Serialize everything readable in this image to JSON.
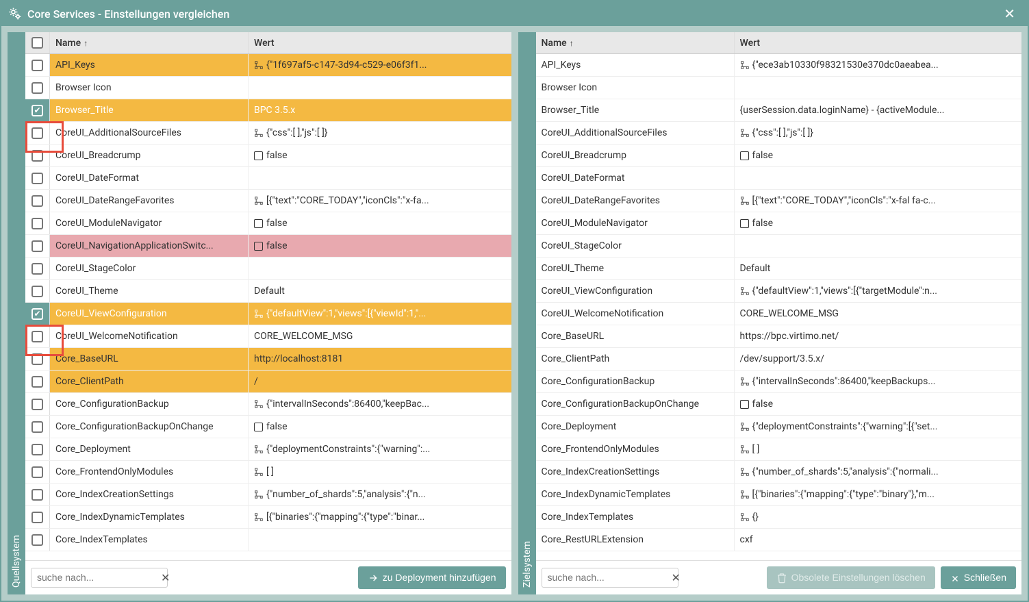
{
  "window": {
    "title": "Core Services - Einstellungen vergleichen"
  },
  "headers": {
    "name": "Name",
    "value": "Wert",
    "sort_indicator": "↑"
  },
  "sidetabs": {
    "source": "Quellsystem",
    "target": "Zielsystem"
  },
  "search": {
    "placeholder": "suche nach...",
    "clear": "✕"
  },
  "buttons": {
    "add_deploy": "zu Deployment hinzufügen",
    "obsolete": "Obsolete Einstellungen löschen",
    "close": "Schließen"
  },
  "source_rows": [
    {
      "name": "API_Keys",
      "value": "{\"1f697af5-c147-3d94-c529-e06f3f1...",
      "state": "diff",
      "icon": "tree",
      "sel": false
    },
    {
      "name": "Browser Icon",
      "value": "",
      "state": "",
      "icon": "",
      "sel": false
    },
    {
      "name": "Browser_Title",
      "value": "BPC 3.5.x",
      "state": "diff",
      "icon": "",
      "sel": true
    },
    {
      "name": "CoreUI_AdditionalSourceFiles",
      "value": "{\"css\":[ ],\"js\":[ ]}",
      "state": "",
      "icon": "tree",
      "sel": false
    },
    {
      "name": "CoreUI_Breadcrump",
      "value": "false",
      "state": "",
      "icon": "bool",
      "sel": false
    },
    {
      "name": "CoreUI_DateFormat",
      "value": "",
      "state": "",
      "icon": "",
      "sel": false
    },
    {
      "name": "CoreUI_DateRangeFavorites",
      "value": "[{\"text\":\"CORE_TODAY\",\"iconCls\":\"x-fa...",
      "state": "",
      "icon": "tree",
      "sel": false
    },
    {
      "name": "CoreUI_ModuleNavigator",
      "value": "false",
      "state": "",
      "icon": "bool",
      "sel": false
    },
    {
      "name": "CoreUI_NavigationApplicationSwitc...",
      "value": "false",
      "state": "missing",
      "icon": "bool",
      "sel": false
    },
    {
      "name": "CoreUI_StageColor",
      "value": "",
      "state": "",
      "icon": "",
      "sel": false
    },
    {
      "name": "CoreUI_Theme",
      "value": "Default",
      "state": "",
      "icon": "",
      "sel": false
    },
    {
      "name": "CoreUI_ViewConfiguration",
      "value": "{\"defaultView\":1,\"views\":[{\"viewId\":1,\"...",
      "state": "diff",
      "icon": "tree",
      "sel": true
    },
    {
      "name": "CoreUI_WelcomeNotification",
      "value": "CORE_WELCOME_MSG",
      "state": "",
      "icon": "",
      "sel": false
    },
    {
      "name": "Core_BaseURL",
      "value": "http://localhost:8181",
      "state": "diff",
      "icon": "",
      "sel": false
    },
    {
      "name": "Core_ClientPath",
      "value": "/",
      "state": "diff",
      "icon": "",
      "sel": false
    },
    {
      "name": "Core_ConfigurationBackup",
      "value": "{\"intervalInSeconds\":86400,\"keepBac...",
      "state": "",
      "icon": "tree",
      "sel": false
    },
    {
      "name": "Core_ConfigurationBackupOnChange",
      "value": "false",
      "state": "",
      "icon": "bool",
      "sel": false
    },
    {
      "name": "Core_Deployment",
      "value": "{\"deploymentConstraints\":{\"warning\":...",
      "state": "",
      "icon": "tree",
      "sel": false
    },
    {
      "name": "Core_FrontendOnlyModules",
      "value": "[ ]",
      "state": "",
      "icon": "tree",
      "sel": false
    },
    {
      "name": "Core_IndexCreationSettings",
      "value": "{\"number_of_shards\":5,\"analysis\":{\"n...",
      "state": "",
      "icon": "tree",
      "sel": false
    },
    {
      "name": "Core_IndexDynamicTemplates",
      "value": "[{\"binaries\":{\"mapping\":{\"type\":\"binar...",
      "state": "",
      "icon": "tree",
      "sel": false
    },
    {
      "name": "Core_IndexTemplates",
      "value": "",
      "state": "",
      "icon": "",
      "sel": false
    }
  ],
  "target_rows": [
    {
      "name": "API_Keys",
      "value": "{\"ece3ab10330f98321530e370dc0aeabea...",
      "icon": "tree"
    },
    {
      "name": "Browser Icon",
      "value": "",
      "icon": ""
    },
    {
      "name": "Browser_Title",
      "value": "{userSession.data.loginName} - {activeModule...",
      "icon": ""
    },
    {
      "name": "CoreUI_AdditionalSourceFiles",
      "value": "{\"css\":[ ],\"js\":[ ]}",
      "icon": "tree"
    },
    {
      "name": "CoreUI_Breadcrump",
      "value": "false",
      "icon": "bool"
    },
    {
      "name": "CoreUI_DateFormat",
      "value": "",
      "icon": ""
    },
    {
      "name": "CoreUI_DateRangeFavorites",
      "value": "[{\"text\":\"CORE_TODAY\",\"iconCls\":\"x-fal fa-c...",
      "icon": "tree"
    },
    {
      "name": "CoreUI_ModuleNavigator",
      "value": "false",
      "icon": "bool"
    },
    {
      "name": "CoreUI_StageColor",
      "value": "",
      "icon": ""
    },
    {
      "name": "CoreUI_Theme",
      "value": "Default",
      "icon": ""
    },
    {
      "name": "CoreUI_ViewConfiguration",
      "value": "{\"defaultView\":1,\"views\":[{\"targetModule\":n...",
      "icon": "tree"
    },
    {
      "name": "CoreUI_WelcomeNotification",
      "value": "CORE_WELCOME_MSG",
      "icon": ""
    },
    {
      "name": "Core_BaseURL",
      "value": "https://bpc.virtimo.net/",
      "icon": ""
    },
    {
      "name": "Core_ClientPath",
      "value": "/dev/support/3.5.x/",
      "icon": ""
    },
    {
      "name": "Core_ConfigurationBackup",
      "value": "{\"intervalInSeconds\":86400,\"keepBackups...",
      "icon": "tree"
    },
    {
      "name": "Core_ConfigurationBackupOnChange",
      "value": "false",
      "icon": "bool"
    },
    {
      "name": "Core_Deployment",
      "value": "{\"deploymentConstraints\":{\"warning\":[{\"set...",
      "icon": "tree"
    },
    {
      "name": "Core_FrontendOnlyModules",
      "value": "[ ]",
      "icon": "tree"
    },
    {
      "name": "Core_IndexCreationSettings",
      "value": "{\"number_of_shards\":5,\"analysis\":{\"normali...",
      "icon": "tree"
    },
    {
      "name": "Core_IndexDynamicTemplates",
      "value": "[{\"binaries\":{\"mapping\":{\"type\":\"binary\"},\"m...",
      "icon": "tree"
    },
    {
      "name": "Core_IndexTemplates",
      "value": "{}",
      "icon": "tree"
    },
    {
      "name": "Core_RestURLExtension",
      "value": "cxf",
      "icon": ""
    }
  ]
}
